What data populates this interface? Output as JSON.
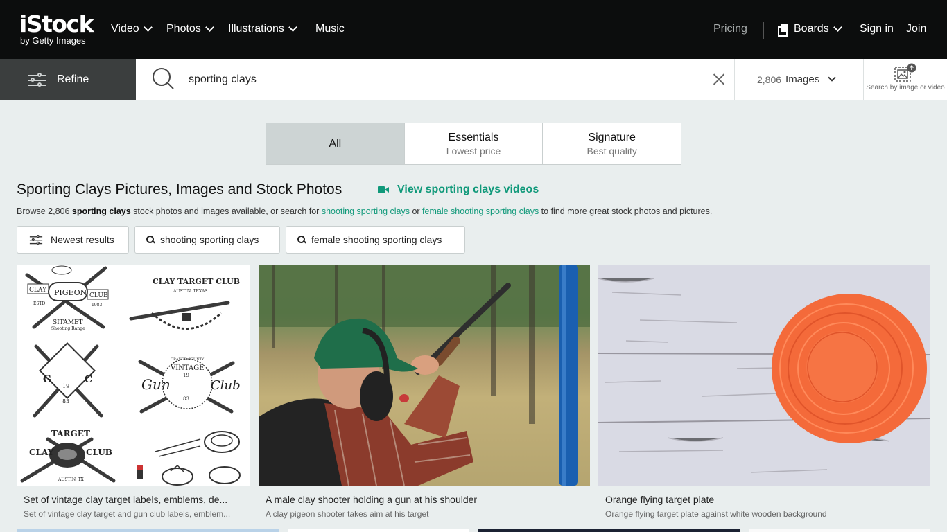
{
  "nav": {
    "logo_main": "iStock",
    "logo_sub": "by Getty Images",
    "items": [
      "Video",
      "Photos",
      "Illustrations",
      "Music"
    ],
    "pricing": "Pricing",
    "boards": "Boards",
    "signin": "Sign in",
    "join": "Join"
  },
  "search": {
    "refine_label": "Refine",
    "query": "sporting clays",
    "count": "2,806",
    "type_label": "Images",
    "image_search_label": "Search by image or video"
  },
  "tabs": [
    {
      "title": "All",
      "subtitle": ""
    },
    {
      "title": "Essentials",
      "subtitle": "Lowest price"
    },
    {
      "title": "Signature",
      "subtitle": "Best quality"
    }
  ],
  "heading": {
    "title": "Sporting Clays Pictures, Images and Stock Photos",
    "video_link": "View sporting clays videos",
    "browse_prefix": "Browse 2,806 ",
    "browse_bold": "sporting clays",
    "browse_mid": " stock photos and images available, or search for ",
    "link1": "shooting sporting clays",
    "browse_or": " or ",
    "link2": "female shooting sporting clays",
    "browse_suffix": " to find more great stock photos and pictures."
  },
  "chips": [
    "Newest results",
    "shooting sporting clays",
    "female shooting sporting clays"
  ],
  "results": [
    {
      "title": "Set of vintage clay target labels, emblems, de...",
      "subtitle": "Set of vintage clay target and gun club labels, emblem..."
    },
    {
      "title": "A male clay shooter holding a gun at his shoulder",
      "subtitle": "A clay pigeon shooter takes aim at his target"
    },
    {
      "title": "Orange flying target plate",
      "subtitle": "Orange flying target plate against white wooden background"
    }
  ],
  "emblems": {
    "clay_pigeon": [
      "CLAY",
      "PIGEON",
      "CLUB",
      "ESTD",
      "1983",
      "SITAMET",
      "Shooting Range"
    ],
    "target_club": [
      "CLAY TARGET CLUB",
      "AUSTIN, TEXAS"
    ],
    "gc": [
      "G",
      "C",
      "19",
      "83"
    ],
    "gun_club": [
      "ORANGE COUNTY",
      "VINTAGE",
      "Gun",
      "Club",
      "19",
      "83"
    ],
    "target": [
      "TARGET",
      "CLAY",
      "CLUB",
      "AUSTIN, TX"
    ]
  },
  "colors": {
    "accent": "#10997a",
    "topbar": "#0c0d0d",
    "refine_bg": "#3b3e3e",
    "page_bg": "#e9eeee",
    "clay_orange": "#f46a3a"
  }
}
